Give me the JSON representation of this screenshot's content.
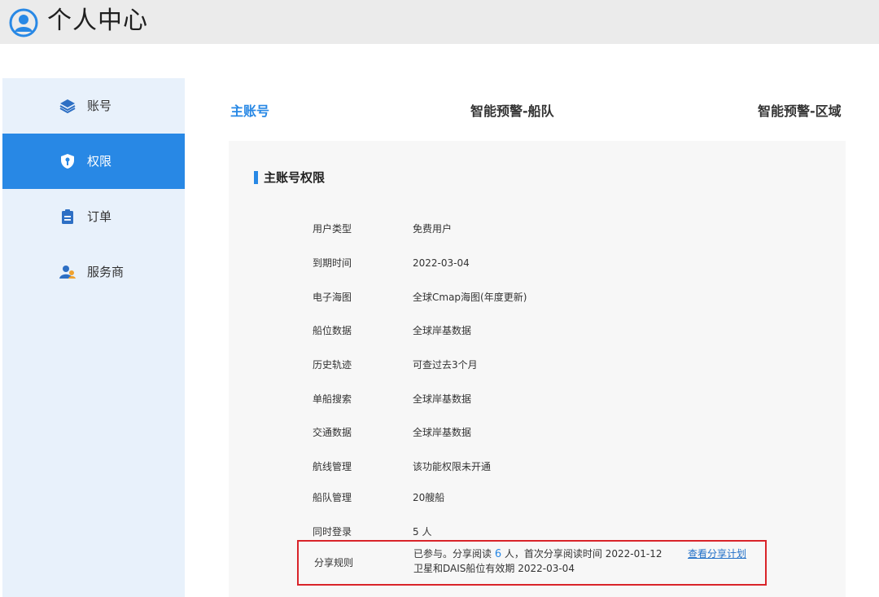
{
  "header": {
    "title": "个人中心",
    "icon": "user-circle-icon"
  },
  "sidebar": {
    "items": [
      {
        "label": "账号",
        "icon": "layers-icon",
        "active": false
      },
      {
        "label": "权限",
        "icon": "shield-key-icon",
        "active": true
      },
      {
        "label": "订单",
        "icon": "clipboard-icon",
        "active": false
      },
      {
        "label": "服务商",
        "icon": "user-group-icon",
        "active": false
      }
    ]
  },
  "tabs": [
    {
      "label": "主账号",
      "active": true
    },
    {
      "label": "智能预警-船队",
      "active": false
    },
    {
      "label": "智能预警-区域",
      "active": false
    }
  ],
  "panel": {
    "title": "主账号权限",
    "rows": [
      {
        "label": "用户类型",
        "value": "免费用户"
      },
      {
        "label": "到期时间",
        "value": "2022-03-04"
      },
      {
        "label": "电子海图",
        "value": "全球Cmap海图(年度更新)"
      },
      {
        "label": "船位数据",
        "value": "全球岸基数据"
      },
      {
        "label": "历史轨迹",
        "value": "可查过去3个月"
      },
      {
        "label": "单船搜索",
        "value": "全球岸基数据"
      },
      {
        "label": "交通数据",
        "value": "全球岸基数据"
      },
      {
        "label": "航线管理",
        "value": "该功能权限未开通"
      },
      {
        "label": "船队管理",
        "value": "20艘船"
      },
      {
        "label": "同时登录",
        "value": "5 人"
      }
    ],
    "share": {
      "label": "分享规则",
      "line1_prefix": "已参与。分享阅读 ",
      "count": "6",
      "line1_suffix": " 人，首次分享阅读时间 2022-01-12",
      "line2": "卫星和DAIS船位有效期 2022-03-04",
      "link": "查看分享计划"
    }
  },
  "colors": {
    "accent": "#2888e5",
    "highlight_border": "#d9242a",
    "sidebar_bg": "#e8f1fb",
    "panel_bg": "#f7f7f7"
  }
}
